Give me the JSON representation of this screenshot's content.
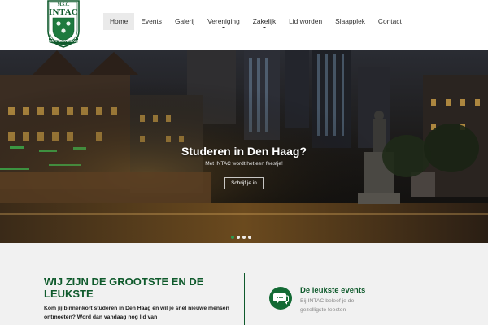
{
  "header": {
    "logo": {
      "top_text": "M.S.C.",
      "name": "INTAC",
      "ribbon_text": "DEN 'S-GRAVENHAGE"
    },
    "nav": {
      "items": [
        {
          "label": "Home",
          "active": true,
          "has_dropdown": false
        },
        {
          "label": "Events",
          "active": false,
          "has_dropdown": false
        },
        {
          "label": "Galerij",
          "active": false,
          "has_dropdown": false
        },
        {
          "label": "Vereniging",
          "active": false,
          "has_dropdown": true
        },
        {
          "label": "Zakelijk",
          "active": false,
          "has_dropdown": true
        },
        {
          "label": "Lid worden",
          "active": false,
          "has_dropdown": false
        },
        {
          "label": "Slaapplek",
          "active": false,
          "has_dropdown": false
        },
        {
          "label": "Contact",
          "active": false,
          "has_dropdown": false
        }
      ]
    }
  },
  "hero": {
    "title": "Studeren in Den Haag?",
    "subtitle": "Met INTAC wordt het een feestje!",
    "button_label": "Schrijf je in",
    "slide_count": 4,
    "active_slide": 1
  },
  "content": {
    "headline": "WIJ ZIJN DE GROOTSTE EN DE LEUKSTE",
    "intro": "Kom jij binnenkort studeren in Den Haag en wil je snel nieuwe mensen ontmoeten? Word dan vandaag nog lid van",
    "feature": {
      "icon": "chat-bubbles-icon",
      "title": "De leukste events",
      "text": "Bij INTAC beleef je de gezelligste feesten"
    }
  },
  "colors": {
    "brand_green": "#0f5a2c",
    "accent_green": "#136a34",
    "active_nav_bg": "#eaeaea",
    "content_bg": "#f1f1f1"
  }
}
